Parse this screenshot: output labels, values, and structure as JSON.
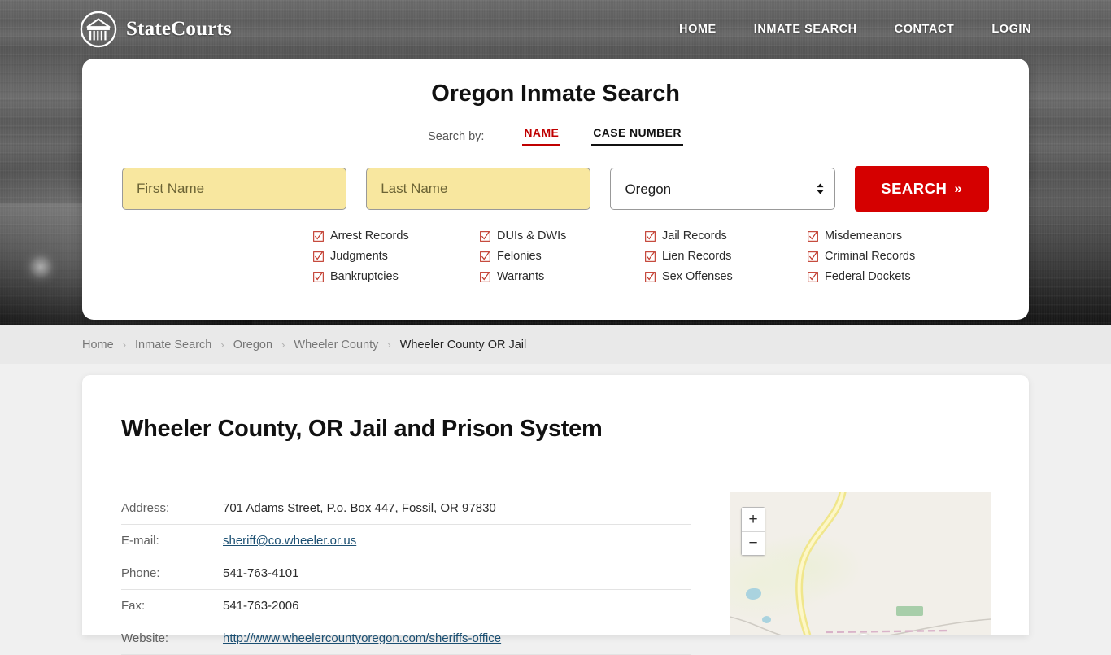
{
  "header": {
    "brand_name": "StateCourts",
    "logo_icon": "courthouse-circle-icon",
    "nav": [
      {
        "label": "HOME",
        "name": "home"
      },
      {
        "label": "INMATE SEARCH",
        "name": "inmate-search"
      },
      {
        "label": "CONTACT",
        "name": "contact"
      },
      {
        "label": "LOGIN",
        "name": "login"
      }
    ]
  },
  "search_card": {
    "title": "Oregon Inmate Search",
    "search_by_label": "Search by:",
    "tabs": [
      {
        "label": "NAME",
        "active": true,
        "accent": "#c00000"
      },
      {
        "label": "CASE NUMBER",
        "active": false,
        "accent": "#111111"
      }
    ],
    "first_name": {
      "placeholder": "First Name",
      "value": ""
    },
    "last_name": {
      "placeholder": "Last Name",
      "value": ""
    },
    "state_select": {
      "value": "Oregon"
    },
    "submit_label": "SEARCH",
    "submit_chevron": "»",
    "submit_color": "#d50000",
    "checkbox_icon": "checked-box-icon",
    "checkbox_color": "#c0392b",
    "record_types": [
      "Arrest Records",
      "DUIs & DWIs",
      "Jail Records",
      "Misdemeanors",
      "Judgments",
      "Felonies",
      "Lien Records",
      "Criminal Records",
      "Bankruptcies",
      "Warrants",
      "Sex Offenses",
      "Federal Dockets"
    ]
  },
  "breadcrumb": {
    "separator": "›",
    "items": [
      {
        "label": "Home",
        "current": false
      },
      {
        "label": "Inmate Search",
        "current": false
      },
      {
        "label": "Oregon",
        "current": false
      },
      {
        "label": "Wheeler County",
        "current": false
      },
      {
        "label": "Wheeler County OR Jail",
        "current": true
      }
    ]
  },
  "main": {
    "title": "Wheeler County, OR Jail and Prison System",
    "info_rows": [
      {
        "key": "Address:",
        "value": "701 Adams Street, P.o. Box 447, Fossil, OR 97830",
        "link": false
      },
      {
        "key": "E-mail:",
        "value": "sheriff@co.wheeler.or.us",
        "link": true
      },
      {
        "key": "Phone:",
        "value": "541-763-4101",
        "link": false
      },
      {
        "key": "Fax:",
        "value": "541-763-2006",
        "link": false
      },
      {
        "key": "Website:",
        "value": "http://www.wheelercountyoregon.com/sheriffs-office",
        "link": true
      }
    ],
    "map": {
      "zoom_in_label": "+",
      "zoom_out_label": "−",
      "marker_icon": "map-marker-icon"
    }
  }
}
